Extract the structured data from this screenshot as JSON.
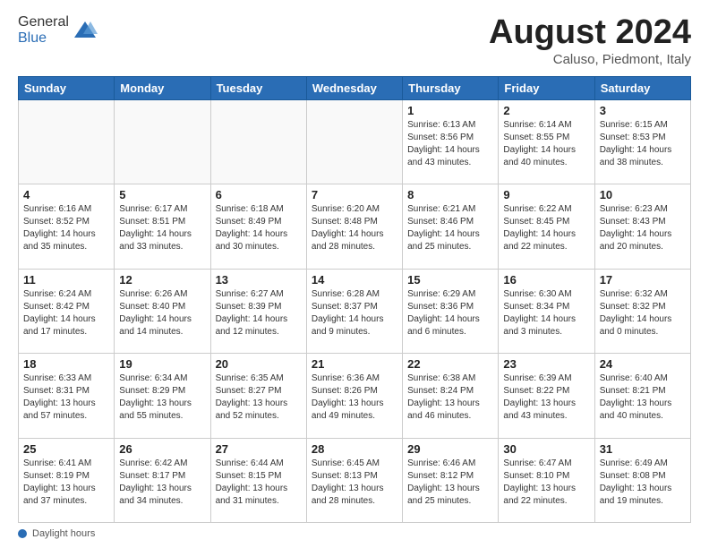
{
  "header": {
    "logo_general": "General",
    "logo_blue": "Blue",
    "month_title": "August 2024",
    "subtitle": "Caluso, Piedmont, Italy"
  },
  "days_of_week": [
    "Sunday",
    "Monday",
    "Tuesday",
    "Wednesday",
    "Thursday",
    "Friday",
    "Saturday"
  ],
  "footer": {
    "label": "Daylight hours"
  },
  "weeks": [
    [
      {
        "day": "",
        "info": ""
      },
      {
        "day": "",
        "info": ""
      },
      {
        "day": "",
        "info": ""
      },
      {
        "day": "",
        "info": ""
      },
      {
        "day": "1",
        "info": "Sunrise: 6:13 AM\nSunset: 8:56 PM\nDaylight: 14 hours and 43 minutes."
      },
      {
        "day": "2",
        "info": "Sunrise: 6:14 AM\nSunset: 8:55 PM\nDaylight: 14 hours and 40 minutes."
      },
      {
        "day": "3",
        "info": "Sunrise: 6:15 AM\nSunset: 8:53 PM\nDaylight: 14 hours and 38 minutes."
      }
    ],
    [
      {
        "day": "4",
        "info": "Sunrise: 6:16 AM\nSunset: 8:52 PM\nDaylight: 14 hours and 35 minutes."
      },
      {
        "day": "5",
        "info": "Sunrise: 6:17 AM\nSunset: 8:51 PM\nDaylight: 14 hours and 33 minutes."
      },
      {
        "day": "6",
        "info": "Sunrise: 6:18 AM\nSunset: 8:49 PM\nDaylight: 14 hours and 30 minutes."
      },
      {
        "day": "7",
        "info": "Sunrise: 6:20 AM\nSunset: 8:48 PM\nDaylight: 14 hours and 28 minutes."
      },
      {
        "day": "8",
        "info": "Sunrise: 6:21 AM\nSunset: 8:46 PM\nDaylight: 14 hours and 25 minutes."
      },
      {
        "day": "9",
        "info": "Sunrise: 6:22 AM\nSunset: 8:45 PM\nDaylight: 14 hours and 22 minutes."
      },
      {
        "day": "10",
        "info": "Sunrise: 6:23 AM\nSunset: 8:43 PM\nDaylight: 14 hours and 20 minutes."
      }
    ],
    [
      {
        "day": "11",
        "info": "Sunrise: 6:24 AM\nSunset: 8:42 PM\nDaylight: 14 hours and 17 minutes."
      },
      {
        "day": "12",
        "info": "Sunrise: 6:26 AM\nSunset: 8:40 PM\nDaylight: 14 hours and 14 minutes."
      },
      {
        "day": "13",
        "info": "Sunrise: 6:27 AM\nSunset: 8:39 PM\nDaylight: 14 hours and 12 minutes."
      },
      {
        "day": "14",
        "info": "Sunrise: 6:28 AM\nSunset: 8:37 PM\nDaylight: 14 hours and 9 minutes."
      },
      {
        "day": "15",
        "info": "Sunrise: 6:29 AM\nSunset: 8:36 PM\nDaylight: 14 hours and 6 minutes."
      },
      {
        "day": "16",
        "info": "Sunrise: 6:30 AM\nSunset: 8:34 PM\nDaylight: 14 hours and 3 minutes."
      },
      {
        "day": "17",
        "info": "Sunrise: 6:32 AM\nSunset: 8:32 PM\nDaylight: 14 hours and 0 minutes."
      }
    ],
    [
      {
        "day": "18",
        "info": "Sunrise: 6:33 AM\nSunset: 8:31 PM\nDaylight: 13 hours and 57 minutes."
      },
      {
        "day": "19",
        "info": "Sunrise: 6:34 AM\nSunset: 8:29 PM\nDaylight: 13 hours and 55 minutes."
      },
      {
        "day": "20",
        "info": "Sunrise: 6:35 AM\nSunset: 8:27 PM\nDaylight: 13 hours and 52 minutes."
      },
      {
        "day": "21",
        "info": "Sunrise: 6:36 AM\nSunset: 8:26 PM\nDaylight: 13 hours and 49 minutes."
      },
      {
        "day": "22",
        "info": "Sunrise: 6:38 AM\nSunset: 8:24 PM\nDaylight: 13 hours and 46 minutes."
      },
      {
        "day": "23",
        "info": "Sunrise: 6:39 AM\nSunset: 8:22 PM\nDaylight: 13 hours and 43 minutes."
      },
      {
        "day": "24",
        "info": "Sunrise: 6:40 AM\nSunset: 8:21 PM\nDaylight: 13 hours and 40 minutes."
      }
    ],
    [
      {
        "day": "25",
        "info": "Sunrise: 6:41 AM\nSunset: 8:19 PM\nDaylight: 13 hours and 37 minutes."
      },
      {
        "day": "26",
        "info": "Sunrise: 6:42 AM\nSunset: 8:17 PM\nDaylight: 13 hours and 34 minutes."
      },
      {
        "day": "27",
        "info": "Sunrise: 6:44 AM\nSunset: 8:15 PM\nDaylight: 13 hours and 31 minutes."
      },
      {
        "day": "28",
        "info": "Sunrise: 6:45 AM\nSunset: 8:13 PM\nDaylight: 13 hours and 28 minutes."
      },
      {
        "day": "29",
        "info": "Sunrise: 6:46 AM\nSunset: 8:12 PM\nDaylight: 13 hours and 25 minutes."
      },
      {
        "day": "30",
        "info": "Sunrise: 6:47 AM\nSunset: 8:10 PM\nDaylight: 13 hours and 22 minutes."
      },
      {
        "day": "31",
        "info": "Sunrise: 6:49 AM\nSunset: 8:08 PM\nDaylight: 13 hours and 19 minutes."
      }
    ]
  ]
}
